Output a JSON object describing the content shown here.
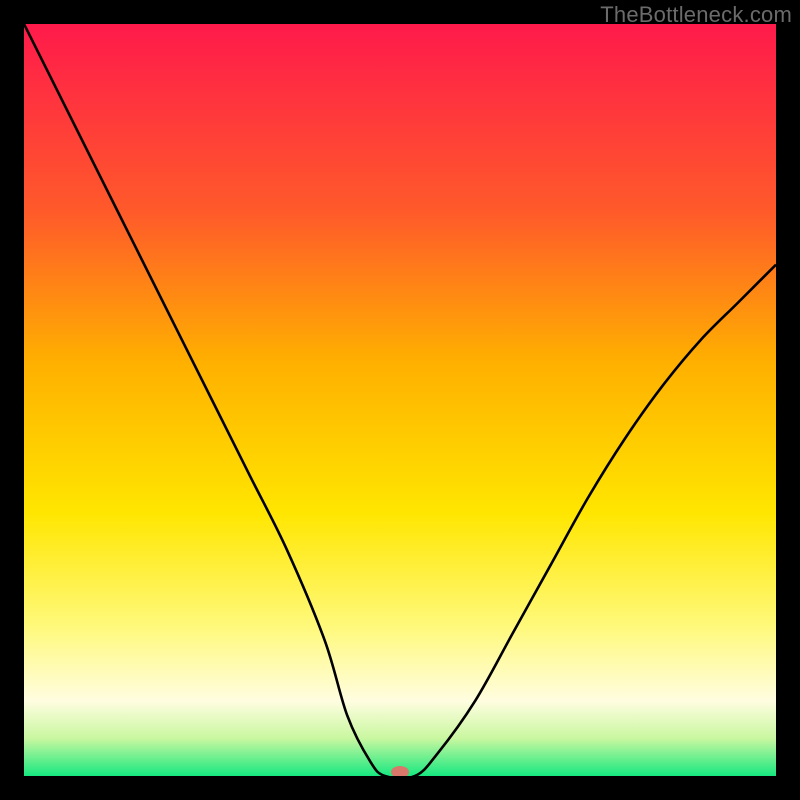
{
  "watermark": "TheBottleneck.com",
  "chart_data": {
    "type": "line",
    "title": "",
    "xlabel": "",
    "ylabel": "",
    "xlim": [
      0,
      100
    ],
    "ylim": [
      0,
      100
    ],
    "legend": false,
    "grid": false,
    "series": [
      {
        "name": "bottleneck-curve",
        "x": [
          0,
          5,
          10,
          15,
          20,
          25,
          30,
          35,
          40,
          43,
          46,
          48,
          52,
          55,
          60,
          65,
          70,
          75,
          80,
          85,
          90,
          95,
          100
        ],
        "values": [
          100,
          90,
          80,
          70,
          60,
          50,
          40,
          30,
          18,
          8,
          2,
          0,
          0,
          3,
          10,
          19,
          28,
          37,
          45,
          52,
          58,
          63,
          68
        ]
      }
    ],
    "marker": {
      "x": 50,
      "y": 0,
      "color": "#d9776a"
    },
    "background_gradient": {
      "stops": [
        {
          "offset": 0.0,
          "color": "#ff1a4b"
        },
        {
          "offset": 0.25,
          "color": "#ff5a2a"
        },
        {
          "offset": 0.45,
          "color": "#ffb000"
        },
        {
          "offset": 0.65,
          "color": "#ffe600"
        },
        {
          "offset": 0.8,
          "color": "#fff97a"
        },
        {
          "offset": 0.9,
          "color": "#fffde0"
        },
        {
          "offset": 0.95,
          "color": "#c9f7a0"
        },
        {
          "offset": 1.0,
          "color": "#17e880"
        }
      ]
    },
    "colors": {
      "curve": "#000000",
      "frame_bg": "#000000"
    }
  }
}
